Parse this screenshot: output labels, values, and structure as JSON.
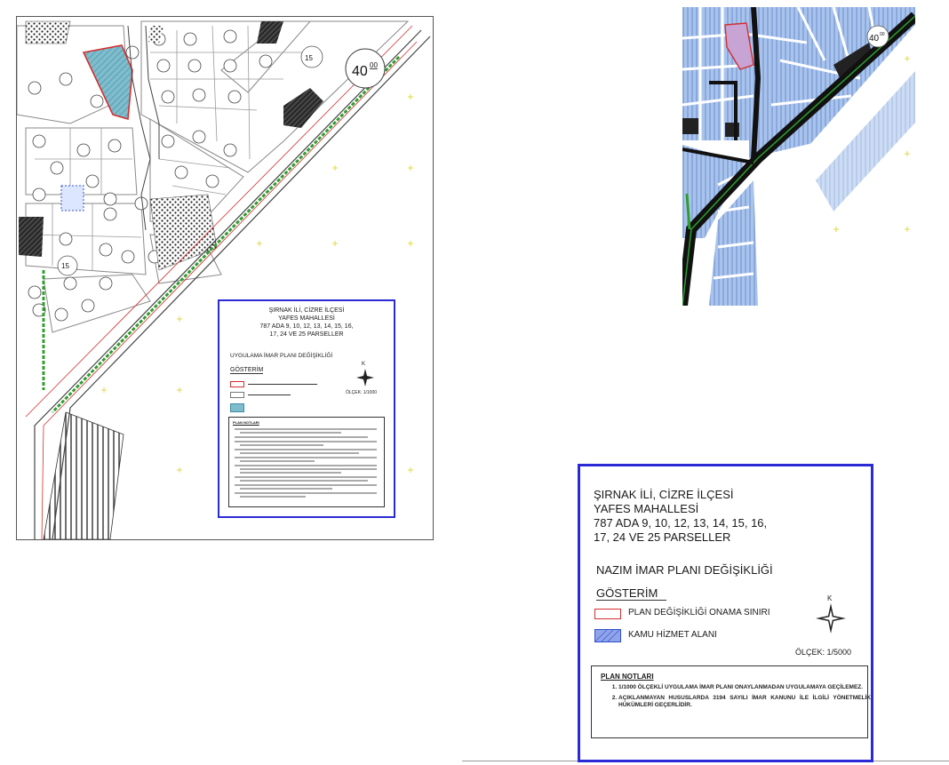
{
  "left_sheet": {
    "road_label": "40",
    "road_label_sup": "00",
    "lot_label": "15",
    "legend": {
      "title_line1": "ŞIRNAK İLİ, CİZRE İLÇESİ",
      "title_line2": "YAFES MAHALLESİ",
      "title_line3": "787 ADA 9, 10, 12, 13, 14, 15, 16,",
      "title_line4": "17, 24 VE 25 PARSELLER",
      "plan_name": "UYGULAMA İMAR PLANI DEĞİŞİKLİĞİ",
      "gosterim": "GÖSTERİM",
      "north": "K",
      "scale": "ÖLÇEK: 1/1000",
      "notes_title": "PLAN NOTLARI"
    }
  },
  "right_sheet": {
    "road_label": "40",
    "road_label_sup": "00",
    "legend": {
      "title_line1": "ŞIRNAK İLİ, CİZRE İLÇESİ",
      "title_line2": "YAFES MAHALLESİ",
      "title_line3": "787 ADA 9, 10, 12, 13, 14, 15, 16,",
      "title_line4": "17, 24 VE 25 PARSELLER",
      "plan_name": "NAZIM İMAR PLANI DEĞİŞİKLİĞİ",
      "gosterim": "GÖSTERİM",
      "item1": "PLAN DEĞİŞİKLİĞİ ONAMA SINIRI",
      "item2": "KAMU HİZMET ALANI",
      "north": "K",
      "scale": "ÖLÇEK: 1/5000",
      "notes_title": "PLAN NOTLARI",
      "note1": "1/1000  ÖLÇEKLİ  UYGULAMA  İMAR  PLANI  ONAYLANMADAN  UYGULAMAYA GEÇİLEMEZ.",
      "note2": "AÇIKLANMAYAN HUSUSLARDA 3194 SAYILI İMAR KANUNU İLE İLGİLİ YÖNETMELİK HÜKÜMLERİ GEÇERLİDİR."
    }
  },
  "colors": {
    "boundary_red": "#d32f2f",
    "legend_blue": "#2b2bd6",
    "road_green": "#2e9e2e",
    "parcel_blue": "#a9c4ec",
    "public_area": "#6fb1c4"
  }
}
